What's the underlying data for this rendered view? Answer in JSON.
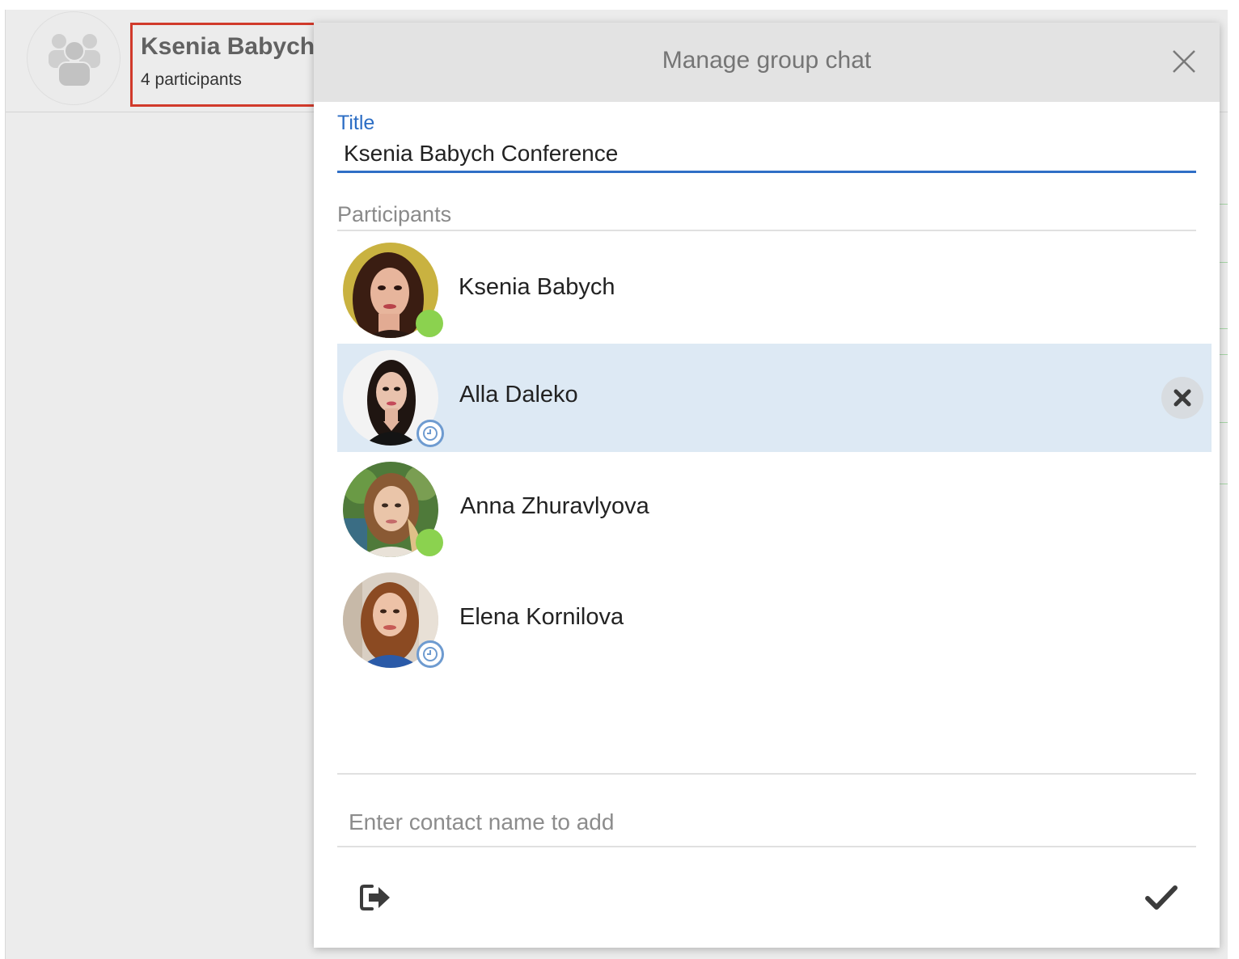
{
  "topic": {
    "name": "Ksenia Babych",
    "subtitle": "4 participants"
  },
  "dialog": {
    "title": "Manage group chat",
    "title_label": "Title",
    "title_value": "Ksenia Babych Conference",
    "participants_label": "Participants",
    "add_placeholder": "Enter contact name to add"
  },
  "participants": [
    {
      "name": "Ksenia Babych",
      "status": "online"
    },
    {
      "name": "Alla Daleko",
      "status": "pending",
      "selected": true
    },
    {
      "name": "Anna Zhuravlyova",
      "status": "online"
    },
    {
      "name": "Elena Kornilova",
      "status": "pending"
    }
  ],
  "colors": {
    "accent": "#2f6fc6",
    "online": "#8bd24f",
    "pending": "#6e9bd0",
    "selected_row": "#dde9f4",
    "highlight_box": "#d13a2b"
  },
  "icons": {
    "close": "close-icon",
    "remove": "remove-icon",
    "leave": "leave-icon",
    "confirm": "checkmark-icon",
    "group": "group-icon",
    "pending": "clock-icon"
  }
}
